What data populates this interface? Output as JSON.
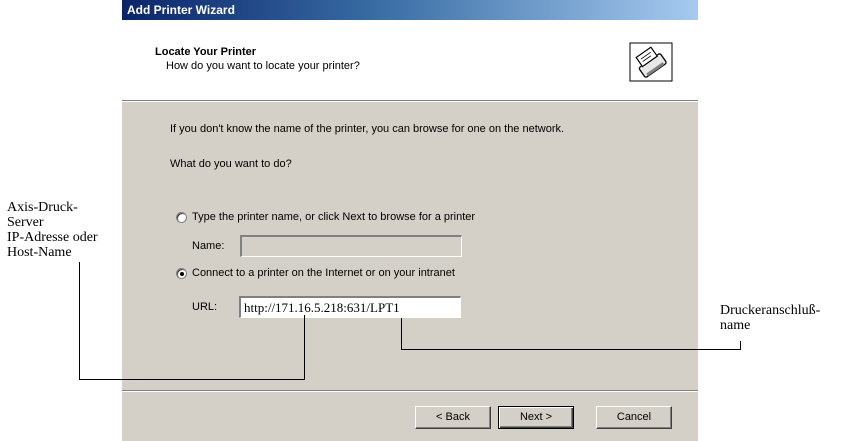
{
  "window": {
    "title": "Add Printer Wizard"
  },
  "header": {
    "title": "Locate Your Printer",
    "subtitle": "How do you want to locate your printer?",
    "icon": "printer-icon"
  },
  "content": {
    "intro": "If you don't know the name of the printer, you can browse for one on the network.",
    "question": "What do you want to do?",
    "option_type_name": {
      "label": "Type the printer name, or click Next to browse for a printer",
      "selected": false
    },
    "name_field": {
      "label": "Name:",
      "value": ""
    },
    "option_internet": {
      "label": "Connect to a printer on the Internet or on your intranet",
      "selected": true
    },
    "url_field": {
      "label": "URL:",
      "value": "http://171.16.5.218:631/LPT1"
    }
  },
  "buttons": {
    "back": "< Back",
    "next": "Next >",
    "cancel": "Cancel"
  },
  "callouts": {
    "left": [
      "Axis-Druck-",
      "Server",
      "IP-Adresse oder",
      "Host-Name"
    ],
    "right": [
      "Druckeranschluß-",
      "name"
    ]
  },
  "colors": {
    "dialog_face": "#d4d0c8",
    "title_gradient_start": "#0a246a",
    "title_gradient_end": "#a6caf0"
  }
}
